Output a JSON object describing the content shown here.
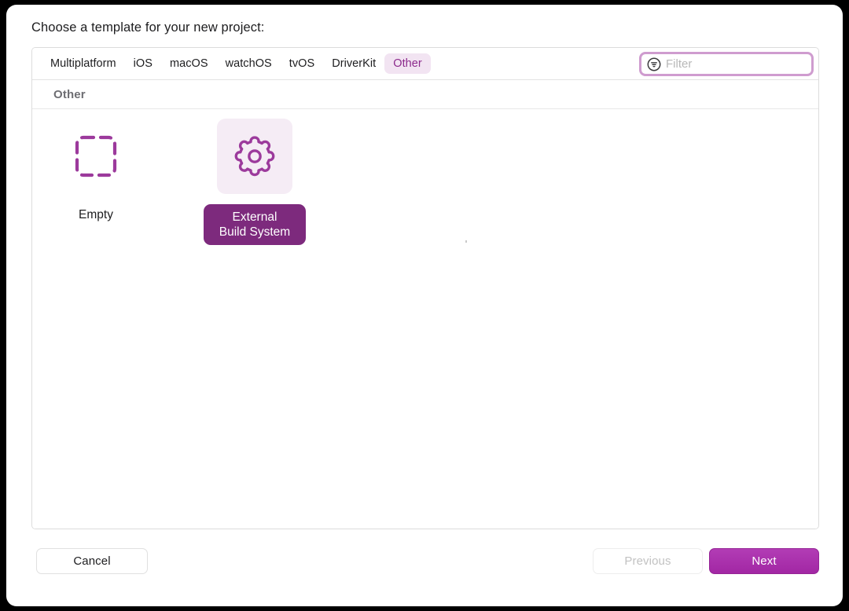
{
  "dialog": {
    "prompt": "Choose a template for your new project:"
  },
  "tabs": [
    {
      "label": "Multiplatform",
      "active": false
    },
    {
      "label": "iOS",
      "active": false
    },
    {
      "label": "macOS",
      "active": false
    },
    {
      "label": "watchOS",
      "active": false
    },
    {
      "label": "tvOS",
      "active": false
    },
    {
      "label": "DriverKit",
      "active": false
    },
    {
      "label": "Other",
      "active": true
    }
  ],
  "filter": {
    "icon": "filter-circle-icon",
    "value": "",
    "placeholder": "Filter",
    "focus_ring_color": "#cf9ccf"
  },
  "section": {
    "header": "Other"
  },
  "templates": [
    {
      "label": "Empty",
      "icon": "dashed-square-icon",
      "selected": false
    },
    {
      "label": "External\nBuild System",
      "icon": "gear-icon",
      "selected": true
    }
  ],
  "footer": {
    "cancel_label": "Cancel",
    "previous_label": "Previous",
    "previous_enabled": false,
    "next_label": "Next",
    "next_enabled": true
  },
  "colors": {
    "accent": "#8c2a8c",
    "accent_fill": "#7d2a7d",
    "next_button": "#a227a4",
    "tab_active_bg": "#f2e4f2",
    "tile_selected_bg": "#f5ecf5"
  }
}
